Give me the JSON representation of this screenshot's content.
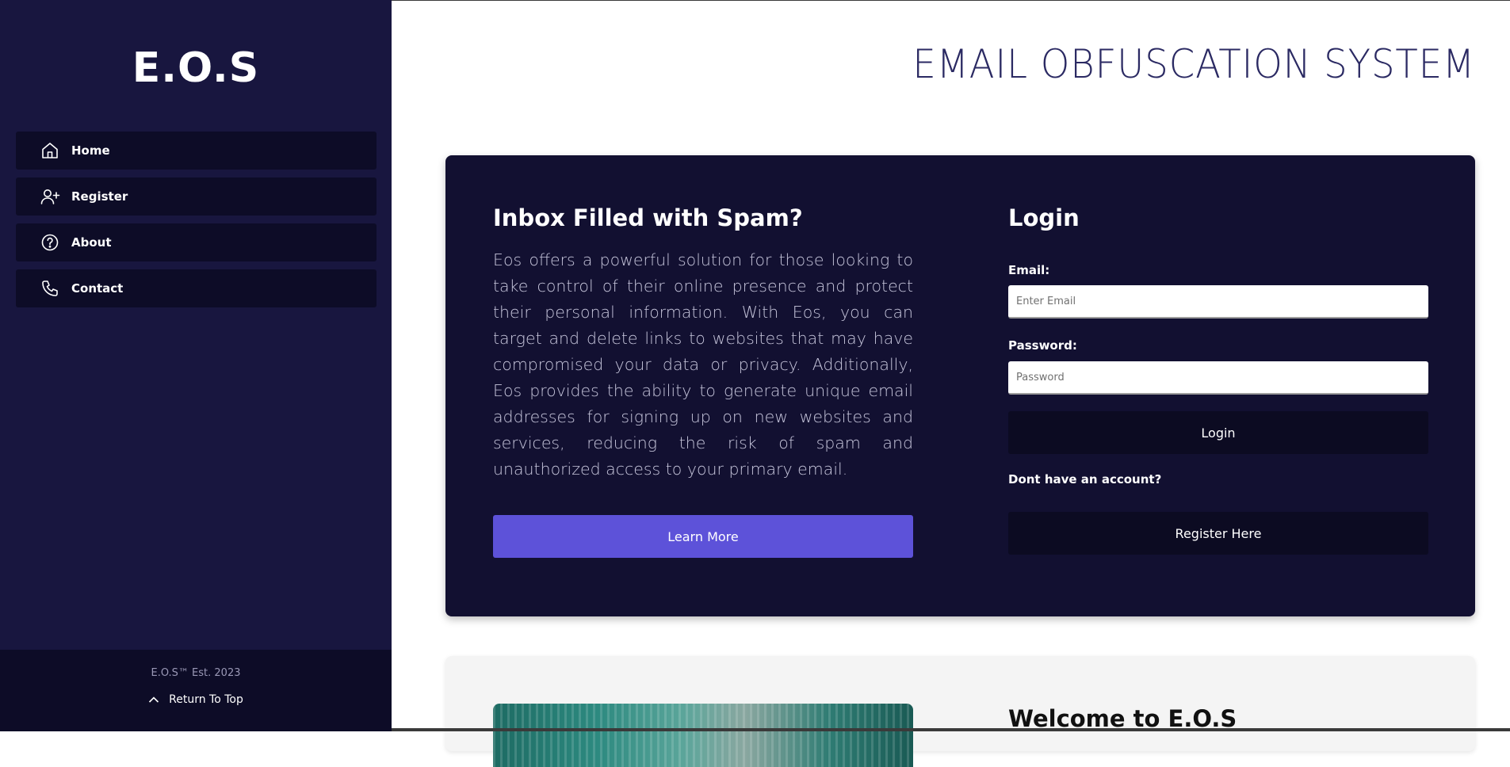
{
  "sidebar": {
    "brand": "E.O.S",
    "items": [
      {
        "label": "Home",
        "icon": "home-icon"
      },
      {
        "label": "Register",
        "icon": "user-plus-icon"
      },
      {
        "label": "About",
        "icon": "help-circle-icon"
      },
      {
        "label": "Contact",
        "icon": "phone-icon"
      }
    ],
    "copyright": "E.O.S™ Est. 2023",
    "return_top": "Return To Top"
  },
  "header": {
    "title": "EMAIL OBFUSCATION SYSTEM"
  },
  "hero": {
    "heading": "Inbox Filled with Spam?",
    "text": "Eos offers a powerful solution for those looking to take control of their online presence and protect their personal information. With Eos, you can target and delete links to websites that may have compromised your data or privacy. Additionally, Eos provides the ability to generate unique email addresses for signing up on new websites and services, reducing the risk of spam and unauthorized access to your primary email.",
    "learn_more": "Learn More"
  },
  "login": {
    "heading": "Login",
    "email_label": "Email:",
    "email_placeholder": "Enter Email",
    "password_label": "Password:",
    "password_placeholder": "Password",
    "submit": "Login",
    "no_account": "Dont have an account?",
    "register": "Register Here"
  },
  "welcome": {
    "heading": "Welcome to E.O.S"
  },
  "colors": {
    "sidebar_bg": "#18163f",
    "sidebar_item_bg": "#0d0c27",
    "hero_bg": "#121031",
    "accent": "#5d52d9",
    "title": "#2b2a63"
  }
}
